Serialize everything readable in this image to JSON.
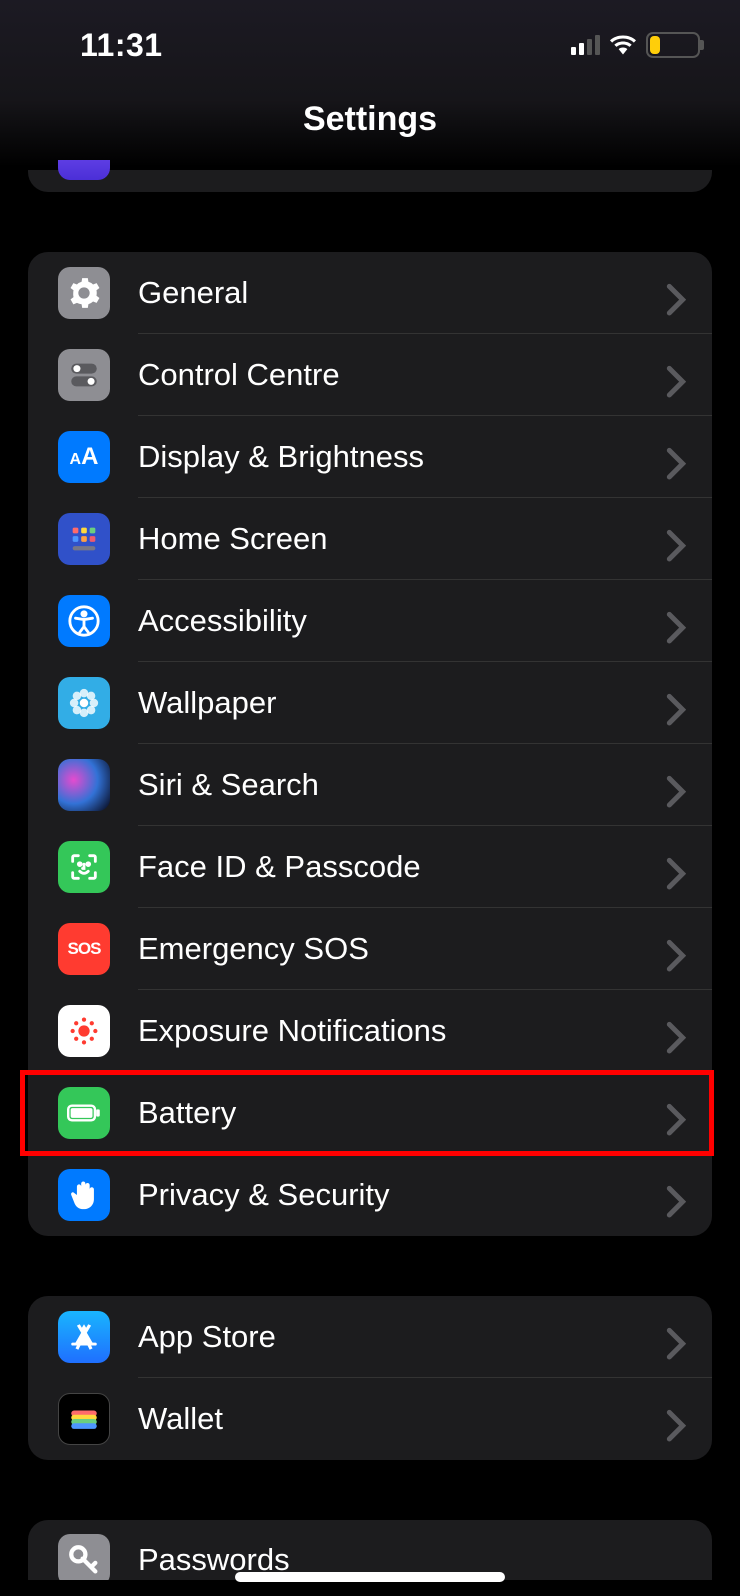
{
  "status": {
    "time": "11:31"
  },
  "header": {
    "title": "Settings"
  },
  "groups": [
    {
      "rows": [
        {
          "label": "General",
          "icon": "gear-icon",
          "bg": "#8e8e93"
        },
        {
          "label": "Control Centre",
          "icon": "toggles-icon",
          "bg": "#8e8e93"
        },
        {
          "label": "Display & Brightness",
          "icon": "text-size-icon",
          "bg": "#007aff"
        },
        {
          "label": "Home Screen",
          "icon": "home-grid-icon",
          "bg": "#3051c9"
        },
        {
          "label": "Accessibility",
          "icon": "accessibility-icon",
          "bg": "#007aff"
        },
        {
          "label": "Wallpaper",
          "icon": "flower-icon",
          "bg": "#32ade6"
        },
        {
          "label": "Siri & Search",
          "icon": "siri-icon",
          "bg": "siri"
        },
        {
          "label": "Face ID & Passcode",
          "icon": "faceid-icon",
          "bg": "#34c759"
        },
        {
          "label": "Emergency SOS",
          "icon": "sos-icon",
          "bg": "#ff3b30"
        },
        {
          "label": "Exposure Notifications",
          "icon": "exposure-icon",
          "bg": "#ffffff"
        },
        {
          "label": "Battery",
          "icon": "battery-icon",
          "bg": "#34c759",
          "highlighted": true
        },
        {
          "label": "Privacy & Security",
          "icon": "hand-icon",
          "bg": "#007aff"
        }
      ]
    },
    {
      "rows": [
        {
          "label": "App Store",
          "icon": "appstore-icon",
          "bg": "#1f8fff"
        },
        {
          "label": "Wallet",
          "icon": "wallet-icon",
          "bg": "#1c1c1e"
        }
      ]
    },
    {
      "rows": [
        {
          "label": "Passwords",
          "icon": "key-icon",
          "bg": "#8e8e93"
        }
      ]
    }
  ]
}
